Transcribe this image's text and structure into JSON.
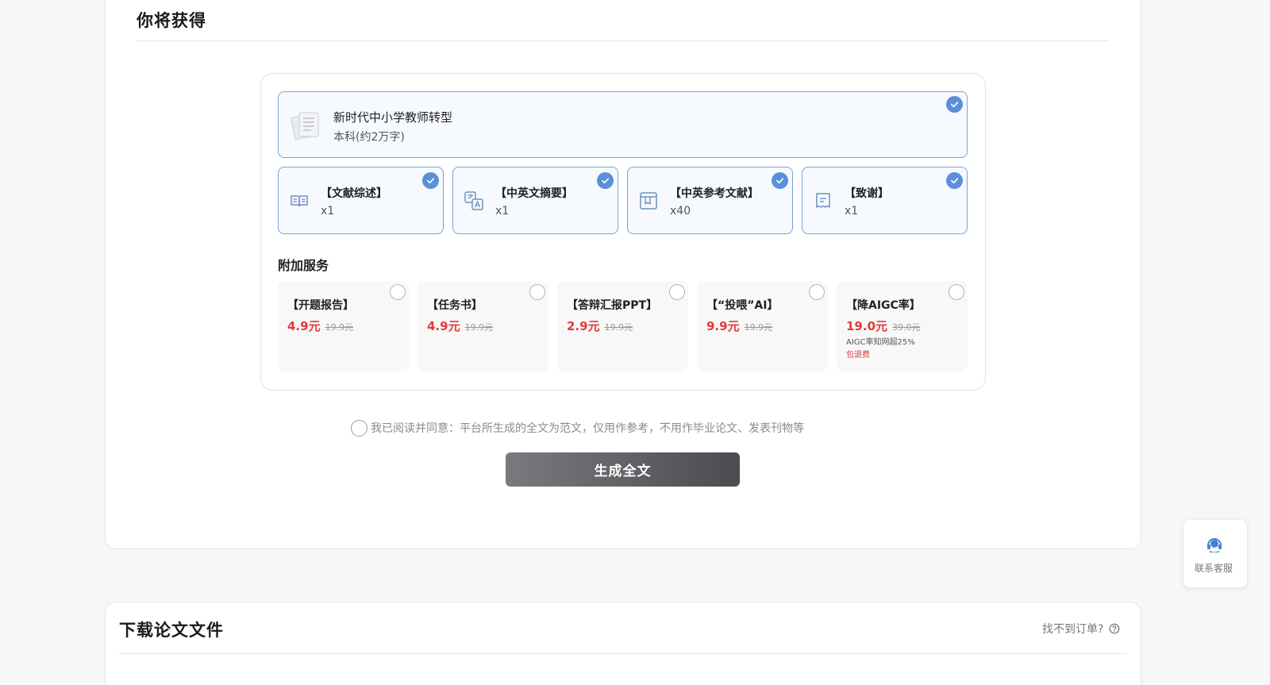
{
  "section": {
    "title": "你将获得"
  },
  "main_item": {
    "title": "新时代中小学教师转型",
    "subtitle": "本科(约2万字)"
  },
  "features": [
    {
      "name": "【文献综述】",
      "count": "x1",
      "icon": "book-open-icon"
    },
    {
      "name": "【中英文摘要】",
      "count": "x1",
      "icon": "translate-icon"
    },
    {
      "name": "【中英参考文献】",
      "count": "x40",
      "icon": "bookmark-book-icon"
    },
    {
      "name": "【致谢】",
      "count": "x1",
      "icon": "document-lines-icon"
    }
  ],
  "addons": {
    "title": "附加服务",
    "items": [
      {
        "name": "【开题报告】",
        "price": "4.9元",
        "original": "19.9元"
      },
      {
        "name": "【任务书】",
        "price": "4.9元",
        "original": "19.9元"
      },
      {
        "name": "【答辩汇报PPT】",
        "price": "2.9元",
        "original": "19.9元"
      },
      {
        "name": "【“投喂”AI】",
        "price": "9.9元",
        "original": "19.9元"
      },
      {
        "name": "【降AIGC率】",
        "price": "19.0元",
        "original": "39.0元",
        "note": "AIGC率知网超25%",
        "note2": "包退费"
      }
    ]
  },
  "agreement": {
    "text": "我已阅读并同意：平台所生成的全文为范文，仅用作参考，不用作毕业论文、发表刊物等"
  },
  "generate_button": {
    "label": "生成全文"
  },
  "download": {
    "title": "下载论文文件",
    "link": "找不到订单?"
  },
  "support": {
    "label": "联系客服"
  },
  "colors": {
    "accent": "#5b8fd9",
    "price": "#e53935",
    "button": "#5a5a5e"
  }
}
